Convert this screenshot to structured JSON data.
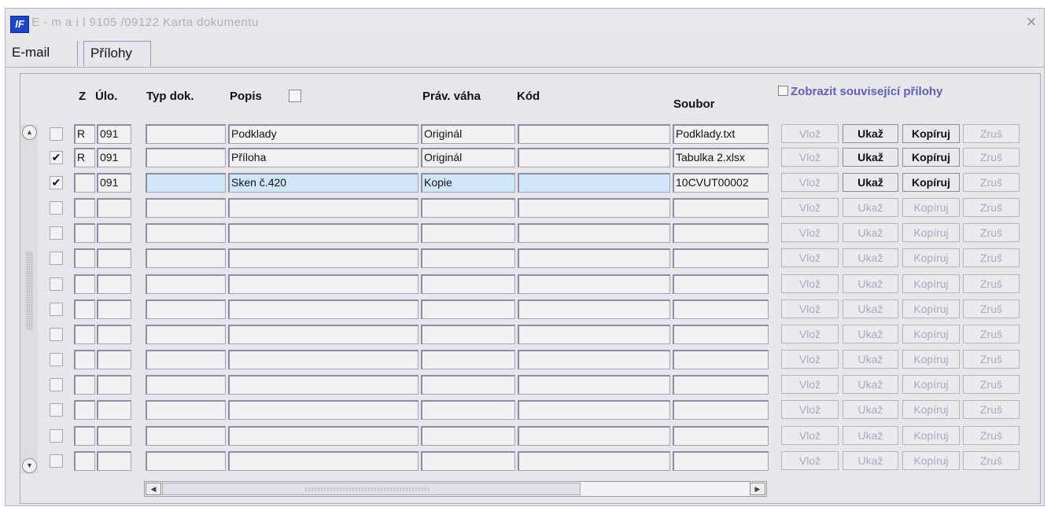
{
  "window": {
    "logo": "IF",
    "title": "E - m a i l   9105 /09122 Karta dokumentu",
    "close": "×"
  },
  "tabs": [
    {
      "label": "E-mail",
      "active": false
    },
    {
      "label": "Přílohy",
      "active": true
    }
  ],
  "headers": {
    "z": "Z",
    "ulo": "Úlo.",
    "typ": "Typ dok.",
    "popis": "Popis",
    "prav": "Práv. váha",
    "kod": "Kód",
    "soubor": "Soubor"
  },
  "related_checkbox": {
    "label": "Zobrazit související přílohy",
    "checked": false
  },
  "buttons": {
    "vloz": "Vlož",
    "ukaz": "Ukaž",
    "kopiruj": "Kopíruj",
    "zrus": "Zruš"
  },
  "rows": [
    {
      "checked": false,
      "z": "R",
      "ulo": "091",
      "typ": "",
      "popis": "Podklady",
      "prav": "Originál",
      "kod": "",
      "soubor": "Podklady.txt",
      "active": true,
      "selected": false
    },
    {
      "checked": true,
      "z": "R",
      "ulo": "091",
      "typ": "",
      "popis": "Příloha",
      "prav": "Originál",
      "kod": "",
      "soubor": "Tabulka 2.xlsx",
      "active": true,
      "selected": false
    },
    {
      "checked": true,
      "z": "",
      "ulo": "091",
      "typ": "",
      "popis": "Sken č.420",
      "prav": "Kopie",
      "kod": "",
      "soubor": "10CVUT00002",
      "active": true,
      "selected": true
    },
    {
      "checked": false,
      "z": "",
      "ulo": "",
      "typ": "",
      "popis": "",
      "prav": "",
      "kod": "",
      "soubor": "",
      "active": false,
      "selected": false
    },
    {
      "checked": false,
      "z": "",
      "ulo": "",
      "typ": "",
      "popis": "",
      "prav": "",
      "kod": "",
      "soubor": "",
      "active": false,
      "selected": false
    },
    {
      "checked": false,
      "z": "",
      "ulo": "",
      "typ": "",
      "popis": "",
      "prav": "",
      "kod": "",
      "soubor": "",
      "active": false,
      "selected": false
    },
    {
      "checked": false,
      "z": "",
      "ulo": "",
      "typ": "",
      "popis": "",
      "prav": "",
      "kod": "",
      "soubor": "",
      "active": false,
      "selected": false
    },
    {
      "checked": false,
      "z": "",
      "ulo": "",
      "typ": "",
      "popis": "",
      "prav": "",
      "kod": "",
      "soubor": "",
      "active": false,
      "selected": false
    },
    {
      "checked": false,
      "z": "",
      "ulo": "",
      "typ": "",
      "popis": "",
      "prav": "",
      "kod": "",
      "soubor": "",
      "active": false,
      "selected": false
    },
    {
      "checked": false,
      "z": "",
      "ulo": "",
      "typ": "",
      "popis": "",
      "prav": "",
      "kod": "",
      "soubor": "",
      "active": false,
      "selected": false
    },
    {
      "checked": false,
      "z": "",
      "ulo": "",
      "typ": "",
      "popis": "",
      "prav": "",
      "kod": "",
      "soubor": "",
      "active": false,
      "selected": false
    },
    {
      "checked": false,
      "z": "",
      "ulo": "",
      "typ": "",
      "popis": "",
      "prav": "",
      "kod": "",
      "soubor": "",
      "active": false,
      "selected": false
    },
    {
      "checked": false,
      "z": "",
      "ulo": "",
      "typ": "",
      "popis": "",
      "prav": "",
      "kod": "",
      "soubor": "",
      "active": false,
      "selected": false
    },
    {
      "checked": false,
      "z": "",
      "ulo": "",
      "typ": "",
      "popis": "",
      "prav": "",
      "kod": "",
      "soubor": "",
      "active": false,
      "selected": false
    }
  ],
  "icons": {
    "scroll_up": "scroll-up-icon",
    "scroll_down": "scroll-down-icon",
    "scroll_left": "scroll-left-icon",
    "scroll_right": "scroll-right-icon"
  },
  "colors": {
    "related_label": "#5d61b3",
    "disabled_button_text": "#a8a9bd",
    "selected_row": "#cfe7fb",
    "logo_bg": "#1b46c8"
  }
}
